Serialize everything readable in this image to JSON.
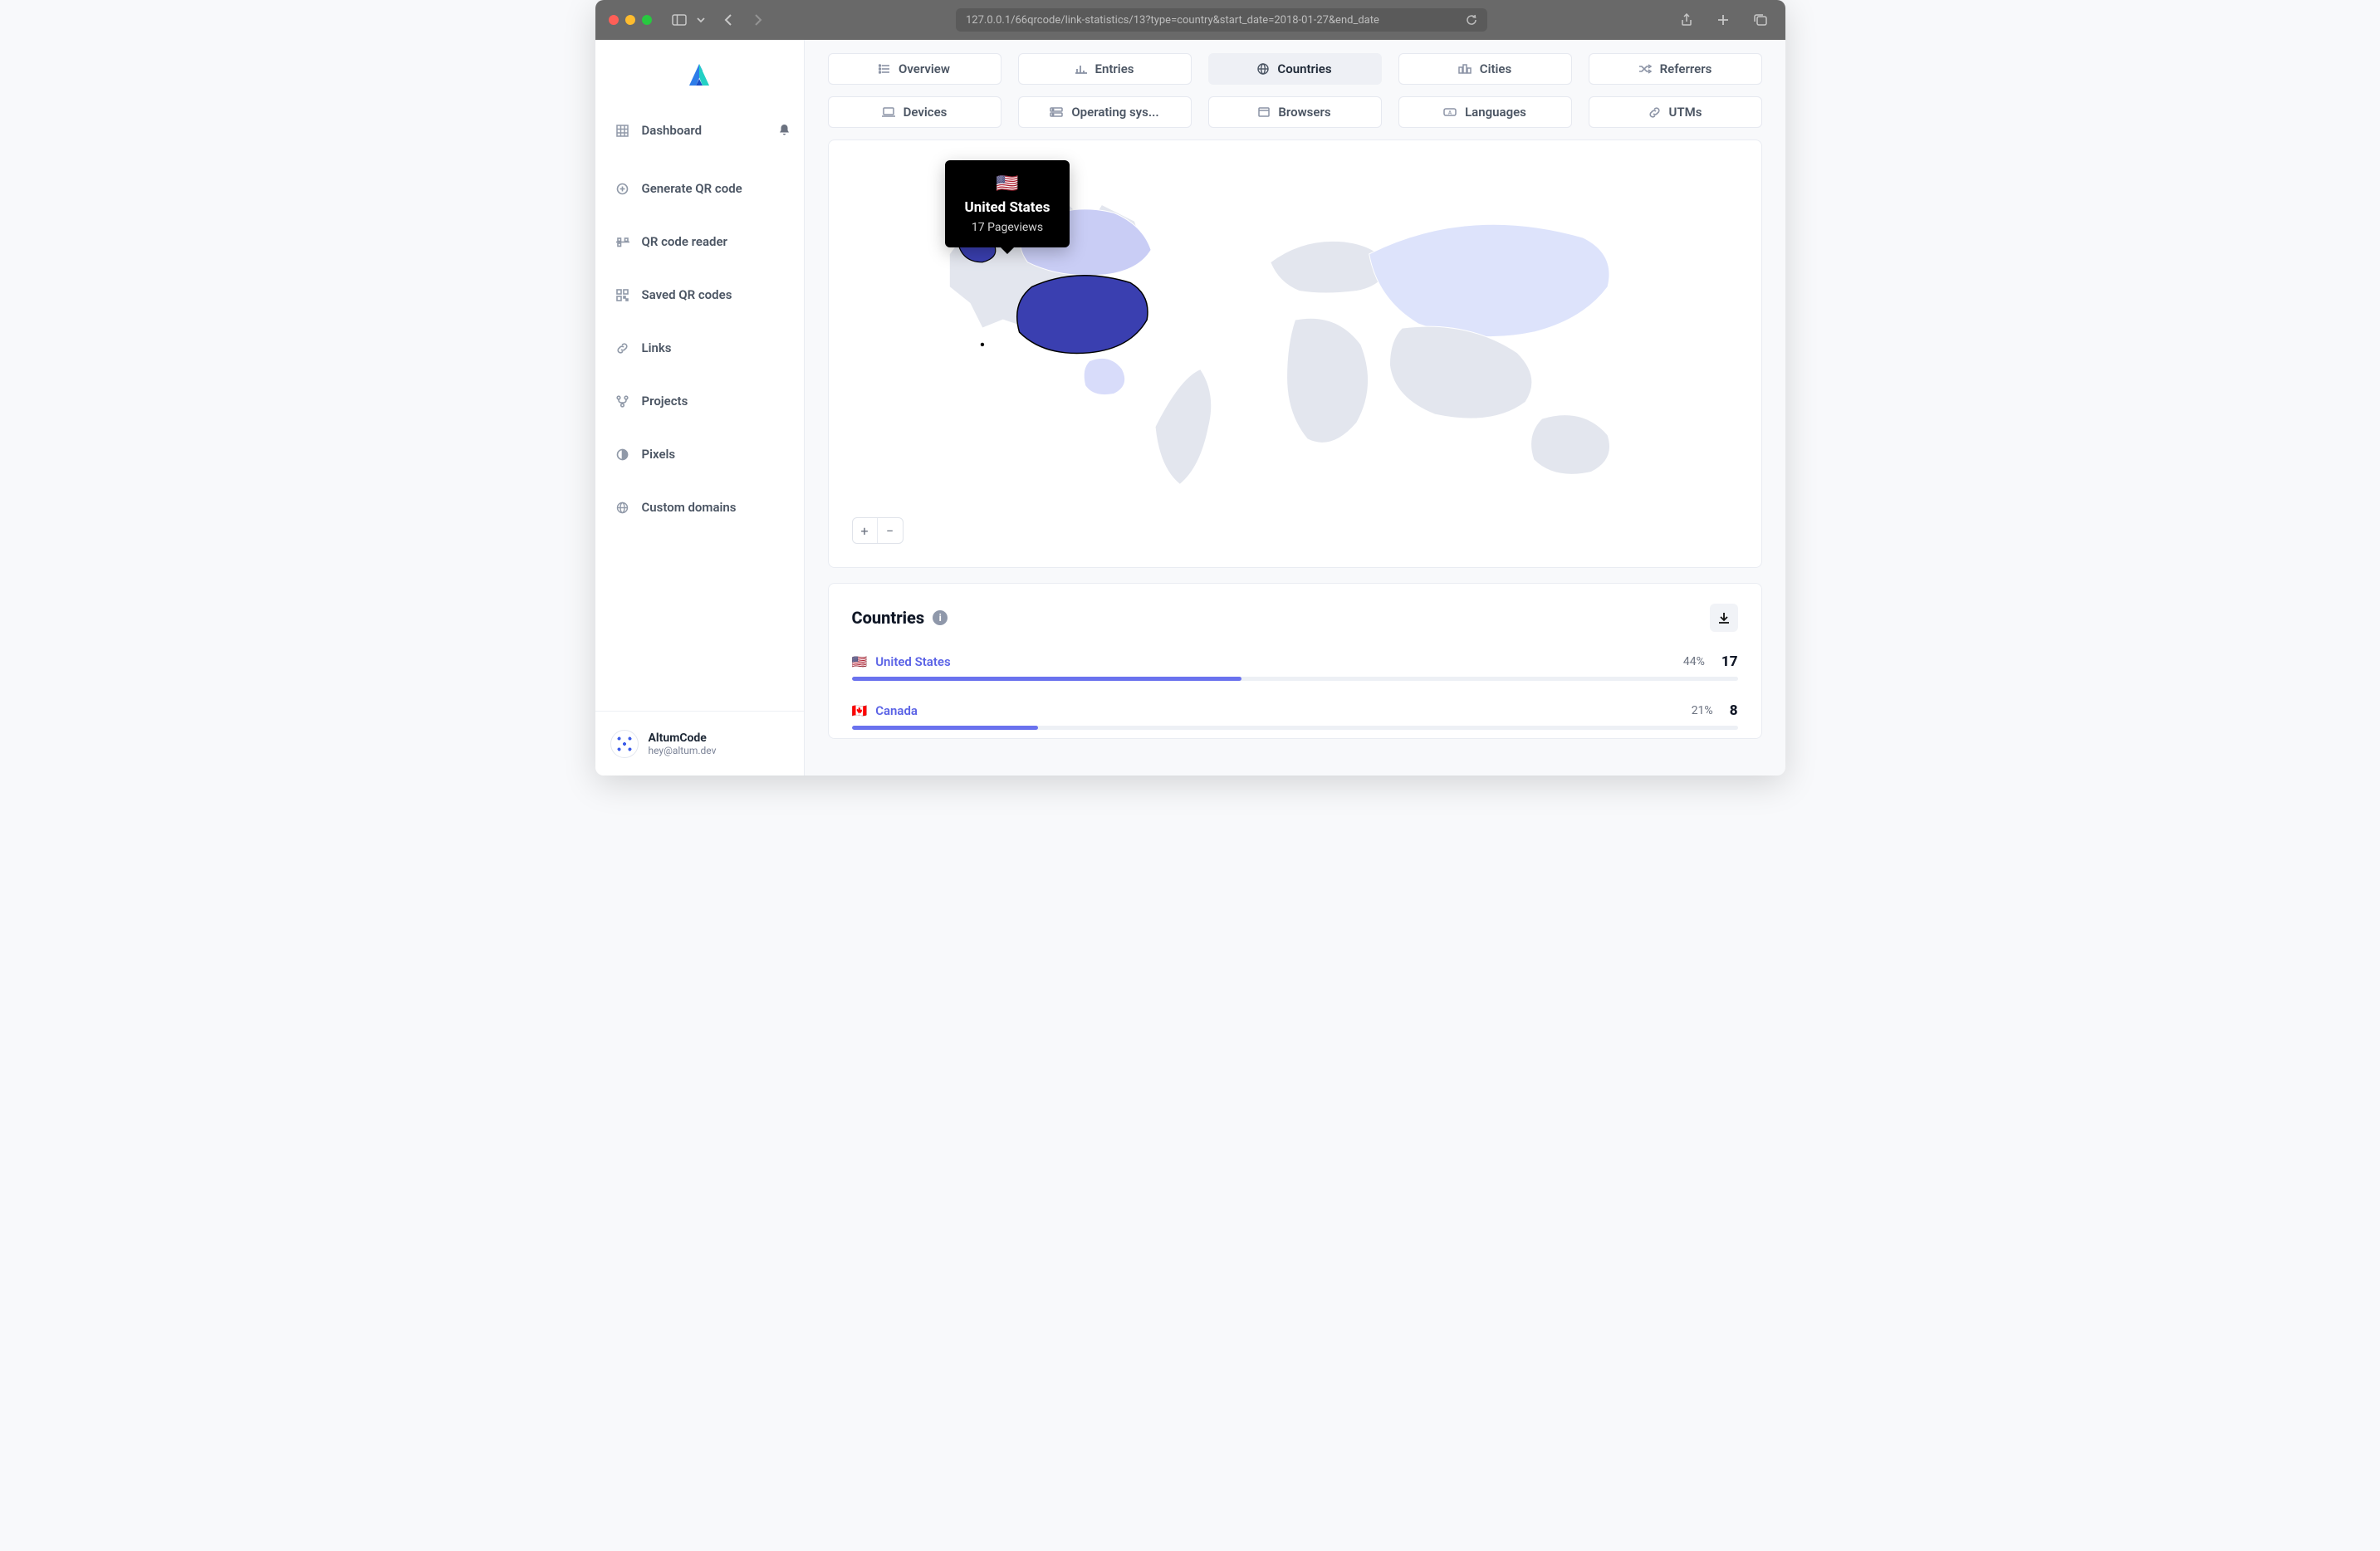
{
  "browser": {
    "url": "127.0.0.1/66qrcode/link-statistics/13?type=country&start_date=2018-01-27&end_date"
  },
  "sidebar": {
    "items": [
      {
        "label": "Dashboard"
      },
      {
        "label": "Generate QR code"
      },
      {
        "label": "QR code reader"
      },
      {
        "label": "Saved QR codes"
      },
      {
        "label": "Links"
      },
      {
        "label": "Projects"
      },
      {
        "label": "Pixels"
      },
      {
        "label": "Custom domains"
      }
    ]
  },
  "user": {
    "name": "AltumCode",
    "email": "hey@altum.dev"
  },
  "tabs": {
    "row1": [
      {
        "label": "Overview"
      },
      {
        "label": "Entries"
      },
      {
        "label": "Countries",
        "active": true
      },
      {
        "label": "Cities"
      },
      {
        "label": "Referrers"
      }
    ],
    "row2": [
      {
        "label": "Devices"
      },
      {
        "label": "Operating sys..."
      },
      {
        "label": "Browsers"
      },
      {
        "label": "Languages"
      },
      {
        "label": "UTMs"
      }
    ]
  },
  "map_tooltip": {
    "flag": "🇺🇸",
    "country": "United States",
    "metric": "17 Pageviews"
  },
  "zoom": {
    "in": "+",
    "out": "−"
  },
  "panel": {
    "title": "Countries",
    "info": "i"
  },
  "countries": [
    {
      "flag": "🇺🇸",
      "name": "United States",
      "pct": "44%",
      "count": "17",
      "bar": 44
    },
    {
      "flag": "🇨🇦",
      "name": "Canada",
      "pct": "21%",
      "count": "8",
      "bar": 21
    }
  ]
}
